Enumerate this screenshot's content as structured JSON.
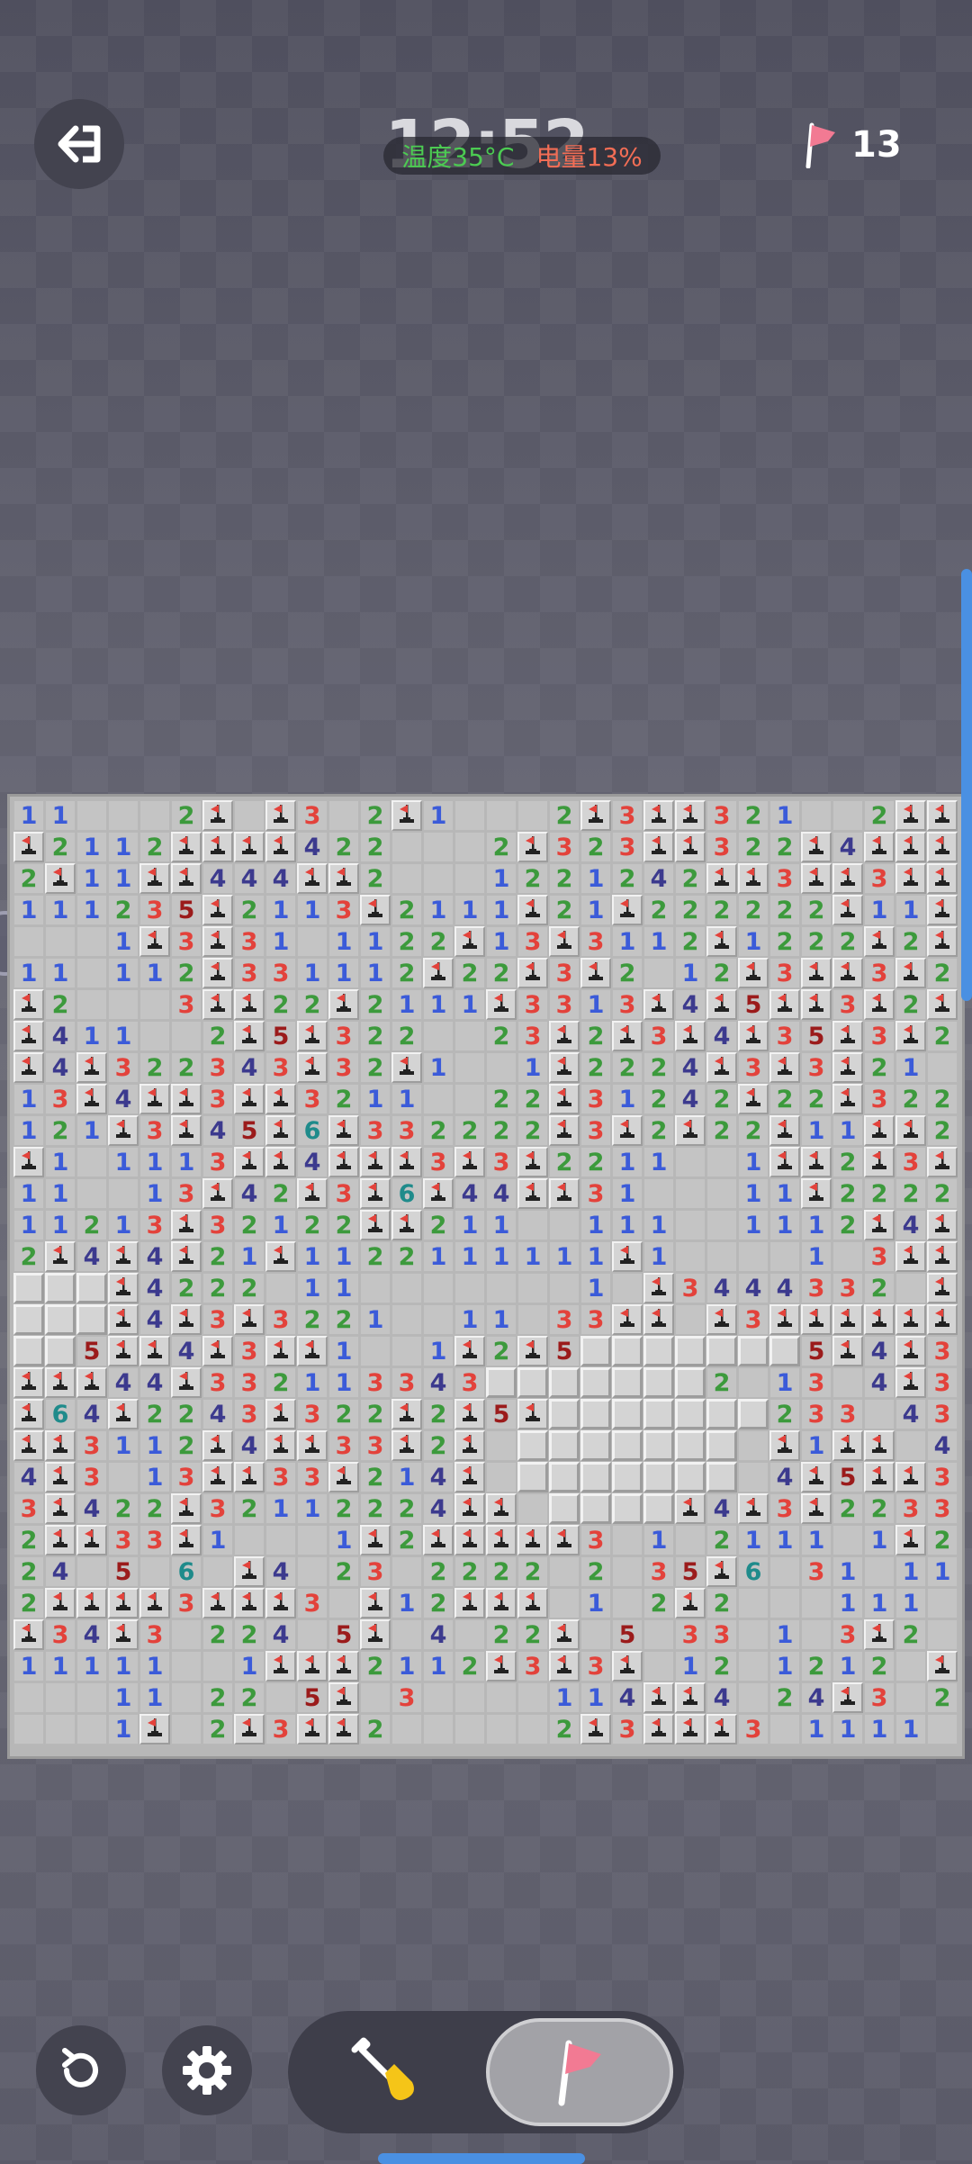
{
  "header": {
    "clock": "12:52",
    "temperature": "温度35°C",
    "battery": "电量13%",
    "flag_count": "13"
  },
  "board": {
    "cols": 30,
    "rows": 30,
    "grid": [
      "11   2F F3 2F1   2F3FF321  2FFFFF",
      "F2112FFFF422   2F323FF322F4FFF42",
      "2F11FF444FF2   1221242FF3FF3FF32",
      "111235F2113F2111F21F222222F11FF",
      "   1F3F31 1122F13F3112F1222F2F33",
      "11 112F331112F22F3F2 12F3FF3F22F",
      "F2   3FF22F2111F3313F4F5FF3F2F3",
      "F411  2F5F322  23F2F3F4F35F3F22F",
      "F4F322343F32F1  1F2224F3F3F21 22",
      "13F4FF3FF3211  22F31242F22F322F",
      "121F3F45F6F332222F3F2F22F11FF2F3F2",
      "F1 1113FF4FFF3F3F2211  1FF2F3F3F2",
      "11  13F42F3F6F44FF31   11F22222F3F3",
      "11213F32122FF211  111  1112F4F221",
      "2F4F4F21F1122111111F1    1 3FF1",
      "CCCF4222 11       1 F3444332 F3F21",
      "CCCF4F3F3221  11 33FF F3FFFFFF5F3  11",
      "CC5FF4F3FF1  1F2F5CCCCCCC5F4F32224F",
      "FFF44F332113343CCCCCCC2 13 4F3FF3FF",
      "F64F2243F322F2F5FCCCCCCC233 43FF3 24F",
      "FF3112F4FF33F2F CCCCCCC F1FF 41  11",
      "4F3 13FF33F214F CCCCCCC 4F5FF31",
      "3F422F32112224FF CCCCF4F3F2233 4F 1",
      "2FF33F1   1F2FFFFF3 1 2111 1F2221 11",
      "24 5 6 F4 23 2222 2 35F6 31 111 1 1 1F12F",
      "2FFFF3FFF3 F12FFF 1 2F2   111 33F",
      "F34F3 224 5F 4 22F 5 33 1 3F2  111 3F",
      "11111  1FFF2112F3F3F 12 1212 F22 33F",
      "   11 22 5F 3    114FF4 24F3 2FF 22 2F 2",
      "   1F 2F3FF2     2F3FFF3 1111 21 1 11"
    ]
  }
}
